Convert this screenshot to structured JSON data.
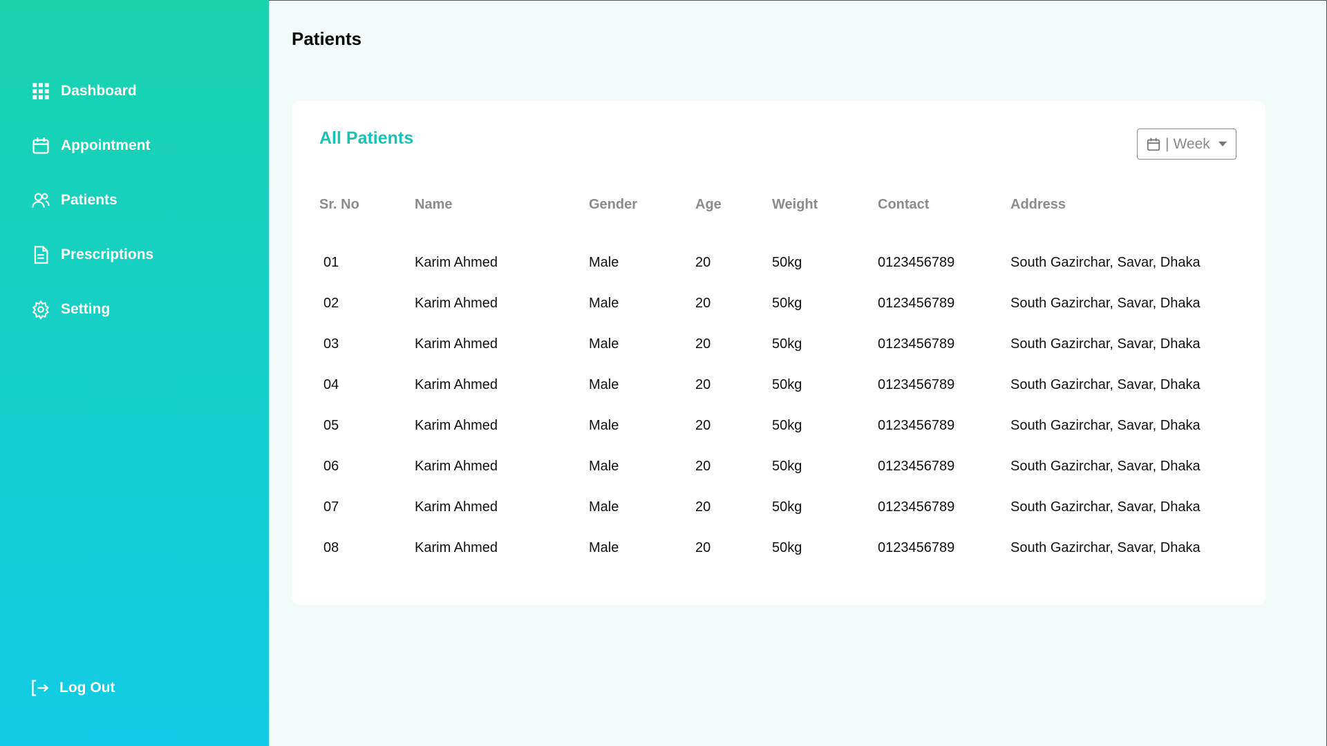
{
  "sidebar": {
    "items": [
      {
        "label": "Dashboard",
        "icon": "grid-icon"
      },
      {
        "label": "Appointment",
        "icon": "calendar-icon"
      },
      {
        "label": "Patients",
        "icon": "users-icon"
      },
      {
        "label": "Prescriptions",
        "icon": "document-icon"
      },
      {
        "label": "Setting",
        "icon": "gear-icon"
      }
    ],
    "logout_label": "Log Out"
  },
  "header": {
    "title": "Patients"
  },
  "card": {
    "title": "All Patients",
    "filter": {
      "value": "Week"
    },
    "columns": [
      "Sr. No",
      "Name",
      "Gender",
      "Age",
      "Weight",
      "Contact",
      "Address"
    ],
    "rows": [
      [
        "01",
        "Karim Ahmed",
        "Male",
        "20",
        "50kg",
        "0123456789",
        "South Gazirchar, Savar, Dhaka"
      ],
      [
        "02",
        "Karim Ahmed",
        "Male",
        "20",
        "50kg",
        "0123456789",
        "South Gazirchar, Savar, Dhaka"
      ],
      [
        "03",
        "Karim Ahmed",
        "Male",
        "20",
        "50kg",
        "0123456789",
        "South Gazirchar, Savar, Dhaka"
      ],
      [
        "04",
        "Karim Ahmed",
        "Male",
        "20",
        "50kg",
        "0123456789",
        "South Gazirchar, Savar, Dhaka"
      ],
      [
        "05",
        "Karim Ahmed",
        "Male",
        "20",
        "50kg",
        "0123456789",
        "South Gazirchar, Savar, Dhaka"
      ],
      [
        "06",
        "Karim Ahmed",
        "Male",
        "20",
        "50kg",
        "0123456789",
        "South Gazirchar, Savar, Dhaka"
      ],
      [
        "07",
        "Karim Ahmed",
        "Male",
        "20",
        "50kg",
        "0123456789",
        "South Gazirchar, Savar, Dhaka"
      ],
      [
        "08",
        "Karim Ahmed",
        "Male",
        "20",
        "50kg",
        "0123456789",
        "South Gazirchar, Savar, Dhaka"
      ]
    ]
  },
  "colors": {
    "accent": "#19c2b5",
    "sidebar_top": "#19d3ad",
    "sidebar_bottom": "#12cbe6"
  }
}
